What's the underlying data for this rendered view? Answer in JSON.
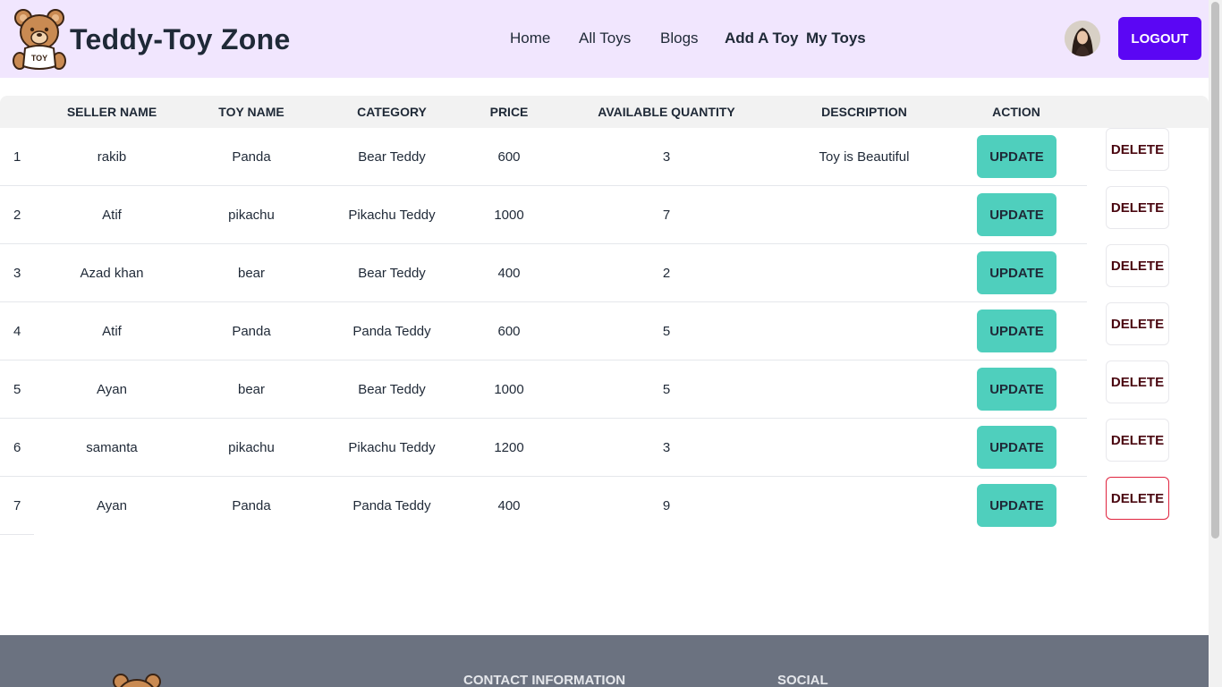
{
  "brand": {
    "title": "Teddy-Toy Zone",
    "logo_text": "TOY",
    "logo_icon": "teddy-bear-icon"
  },
  "nav": {
    "items": [
      {
        "label": "Home",
        "bold": false
      },
      {
        "label": "All Toys",
        "bold": false
      },
      {
        "label": "Blogs",
        "bold": false
      },
      {
        "label": "Add A Toy",
        "bold": true
      },
      {
        "label": "My Toys",
        "bold": true
      }
    ],
    "logout_label": "LOGOUT"
  },
  "table": {
    "headers": [
      "SELLER NAME",
      "TOY NAME",
      "CATEGORY",
      "PRICE",
      "AVAILABLE QUANTITY",
      "DESCRIPTION",
      "ACTION"
    ],
    "update_label": "UPDATE",
    "delete_label": "DELETE",
    "rows": [
      {
        "index": "1",
        "seller": "rakib",
        "toy": "Panda",
        "category": "Bear Teddy",
        "price": "600",
        "quantity": "3",
        "description": "Toy is Beautiful"
      },
      {
        "index": "2",
        "seller": "Atif",
        "toy": "pikachu",
        "category": "Pikachu Teddy",
        "price": "1000",
        "quantity": "7",
        "description": ""
      },
      {
        "index": "3",
        "seller": "Azad khan",
        "toy": "bear",
        "category": "Bear Teddy",
        "price": "400",
        "quantity": "2",
        "description": ""
      },
      {
        "index": "4",
        "seller": "Atif",
        "toy": "Panda",
        "category": "Panda Teddy",
        "price": "600",
        "quantity": "5",
        "description": ""
      },
      {
        "index": "5",
        "seller": "Ayan",
        "toy": "bear",
        "category": "Bear Teddy",
        "price": "1000",
        "quantity": "5",
        "description": ""
      },
      {
        "index": "6",
        "seller": "samanta",
        "toy": "pikachu",
        "category": "Pikachu Teddy",
        "price": "1200",
        "quantity": "3",
        "description": ""
      },
      {
        "index": "7",
        "seller": "Ayan",
        "toy": "Panda",
        "category": "Panda Teddy",
        "price": "400",
        "quantity": "9",
        "description": ""
      }
    ]
  },
  "footer": {
    "headings": [
      "CONTACT INFORMATION",
      "SOCIAL"
    ]
  },
  "colors": {
    "navbar_bg": "#f1e6fe",
    "logout_bg": "#5b06f4",
    "update_bg": "#4fcfbd",
    "delete_text": "#4a0710",
    "delete_active_border": "#e0243f",
    "footer_bg": "#6b7280"
  }
}
